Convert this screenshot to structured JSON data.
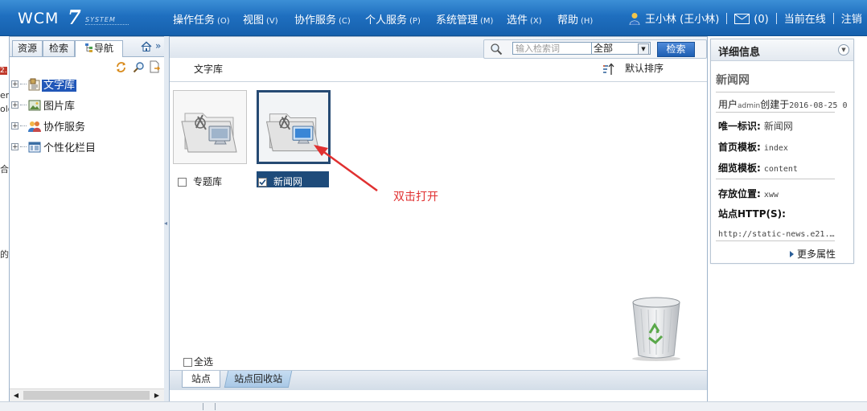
{
  "topbar": {
    "logo_wcm": "WCM",
    "logo_seven": "7",
    "logo_system": "SYSTEM",
    "menu": [
      {
        "label": "操作任务",
        "key": "(O)"
      },
      {
        "label": "视图",
        "key": "(V)"
      },
      {
        "label": "协作服务",
        "key": "(C)"
      },
      {
        "label": "个人服务",
        "key": "(P)"
      },
      {
        "label": "系统管理",
        "key": "(M)"
      },
      {
        "label": "选件",
        "key": "(X)"
      },
      {
        "label": "帮助",
        "key": "(H)"
      }
    ],
    "user": "王小林 (王小林)",
    "mail_count": "(0)",
    "online": "当前在线",
    "logout": "注销"
  },
  "left_edge": [
    "2.",
    "er",
    "olo",
    "合",
    "的"
  ],
  "leftpanel": {
    "tabs": [
      "资源",
      "检索",
      "导航"
    ],
    "active_tab": 2,
    "tree": [
      {
        "label": "文字库",
        "icon": "text-library-icon",
        "selected": true
      },
      {
        "label": "图片库",
        "icon": "picture-library-icon",
        "selected": false
      },
      {
        "label": "协作服务",
        "icon": "collaboration-icon",
        "selected": false
      },
      {
        "label": "个性化栏目",
        "icon": "custom-column-icon",
        "selected": false
      }
    ]
  },
  "center": {
    "search": {
      "placeholder": "输入检索词",
      "scope": "全部",
      "button": "检索"
    },
    "breadcrumb": "文字库",
    "sort_label": "默认排序",
    "sites": [
      {
        "label": "专题库",
        "checked": false,
        "selected": false
      },
      {
        "label": "新闻网",
        "checked": true,
        "selected": true
      }
    ],
    "callout": "双击打开",
    "select_all": "全选",
    "bottom_tabs": [
      "站点",
      "站点回收站"
    ]
  },
  "detail": {
    "title": "详细信息",
    "site_name": "新闻网",
    "creator_prefix": "用户",
    "creator_user": "admin",
    "creator_suffix": "创建于",
    "created": "2016-08-25 0",
    "rows": [
      {
        "key": "唯一标识:",
        "value": "新闻网"
      },
      {
        "key": "首页模板:",
        "value": "index"
      },
      {
        "key": "细览模板:",
        "value": "content"
      },
      {
        "key": "存放位置:",
        "value": "xww"
      },
      {
        "key": "站点HTTP(S):",
        "value": ""
      }
    ],
    "http_value": "http://static-news.e21.…",
    "more": "更多属性"
  },
  "colors": {
    "topbar": "#1f6fbf",
    "selection": "#2157b8",
    "selected_card": "#264a73",
    "callout": "#e03030"
  }
}
